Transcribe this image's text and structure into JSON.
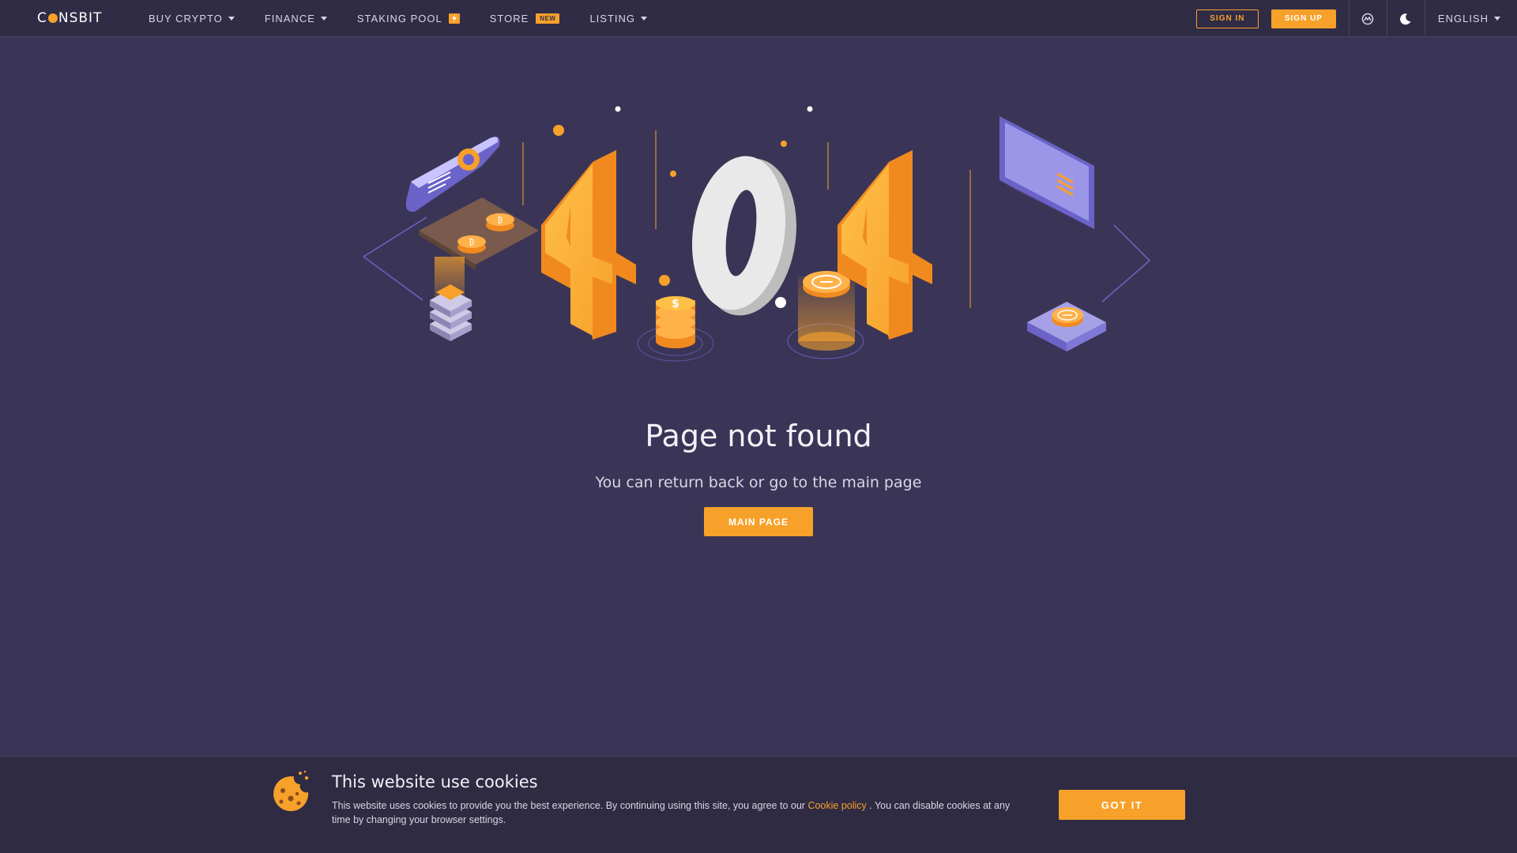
{
  "header": {
    "logo": {
      "prefix": "C",
      "suffix": "NSBIT"
    },
    "nav": [
      {
        "label": "BUY CRYPTO"
      },
      {
        "label": "FINANCE"
      },
      {
        "label": "STAKING POOL"
      },
      {
        "label": "STORE",
        "badge": "NEW"
      },
      {
        "label": "LISTING"
      }
    ],
    "sign_in": "SIGN IN",
    "sign_up": "SIGN UP",
    "language": "ENGLISH"
  },
  "error": {
    "title": "Page not found",
    "subtitle": "You can return back or go to the main page",
    "main_button": "MAIN PAGE"
  },
  "cookie": {
    "title": "This website use cookies",
    "text_before": "This website uses cookies to provide you the best experience. By continuing using this site, you agree to our ",
    "link": "Cookie policy",
    "text_after": " . You can disable cookies at any time by changing your browser settings.",
    "button": "GOT IT"
  },
  "colors": {
    "accent": "#f7a12b",
    "background": "#3a3556",
    "header_bg": "#302c46"
  },
  "icons": {
    "chart_toggle": "coinmarket-icon",
    "theme_toggle": "moon-icon",
    "staking_badge": "bolt-icon"
  }
}
